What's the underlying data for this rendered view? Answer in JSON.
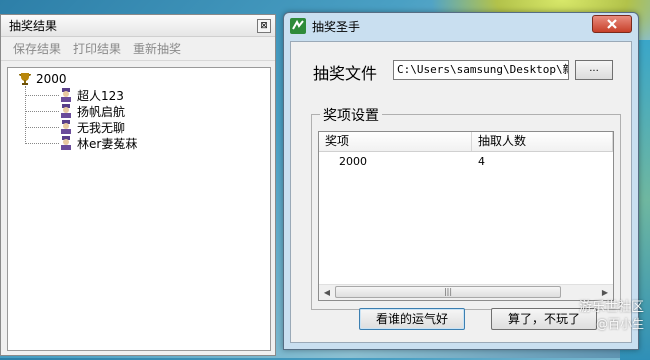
{
  "left_panel": {
    "title": "抽奖结果",
    "close_glyph": "⊠",
    "toolbar": [
      "保存结果",
      "打印结果",
      "重新抽奖"
    ],
    "tree": {
      "root": "2000",
      "children": [
        "超人123",
        "扬帆启航",
        "无我无聊",
        "林er妻菟菻"
      ]
    }
  },
  "dialog": {
    "title": "抽奖圣手",
    "file_label": "抽奖文件",
    "file_path": "C:\\Users\\samsung\\Desktop\\新建",
    "browse_label": "...",
    "group_title": "奖项设置",
    "columns": [
      "奖项",
      "抽取人数"
    ],
    "rows": [
      {
        "prize": "2000",
        "count": "4"
      }
    ],
    "primary_button": "看谁的运气好",
    "secondary_button": "算了，不玩了"
  },
  "watermark": {
    "line1": "游乐世社区",
    "line2": "@百小生"
  },
  "colors": {
    "titlebar_dialog": "#c9dff0",
    "close_red": "#c7402a",
    "desktop": "#4aa0c4"
  },
  "icons": {
    "trophy": "trophy-icon",
    "person": "person-icon",
    "app": "app-icon",
    "close": "close-icon"
  }
}
